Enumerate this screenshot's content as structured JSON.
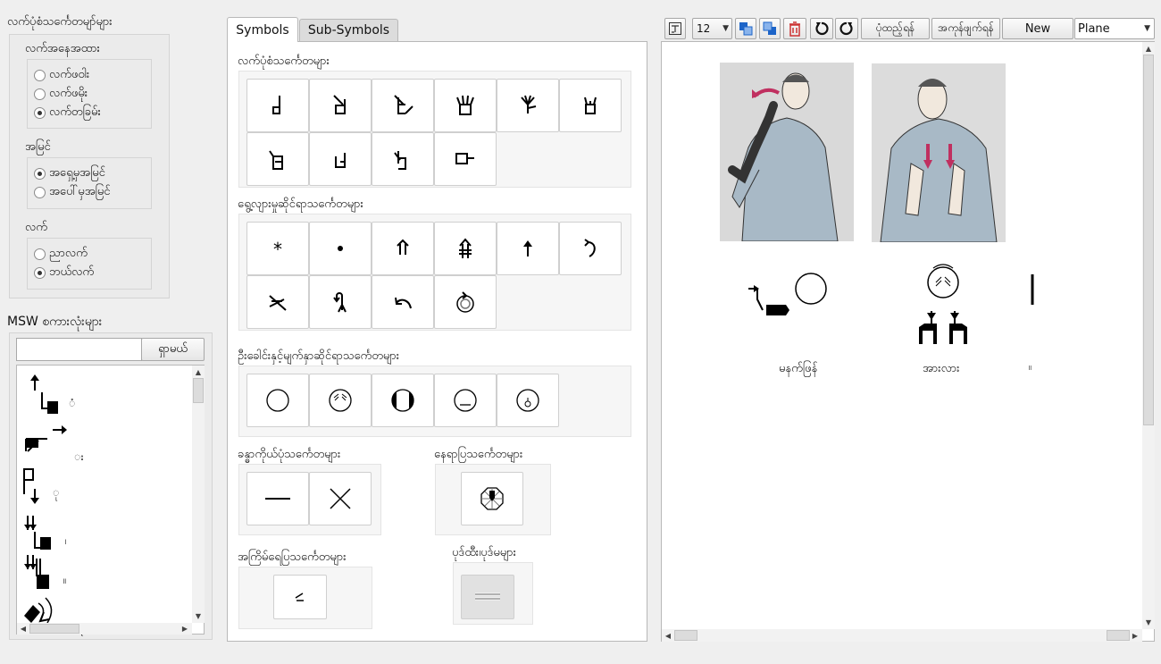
{
  "left": {
    "handshapes_title": "လက်ပုံစံသင်္ကေတမျာ်များ",
    "hand_position_title": "လက်အနေအထား",
    "hand_position_options": [
      "လက်ဖဝါး",
      "လက်ဖမိုး",
      "လက်တခြမ်း"
    ],
    "hand_position_selected": 2,
    "view_title": "အမြင်",
    "view_options": [
      "အရှေ့မှအမြင်",
      "အပေါ်မှအမြင်"
    ],
    "view_selected": 0,
    "hand_title": "လက်",
    "hand_options": [
      "ညာလက်",
      "ဘယ်လက်"
    ],
    "hand_selected": 1,
    "msw_title": "MSW စကားလုံးများ",
    "search_value": "",
    "search_button": "ရှာမယ်",
    "word_marks": [
      "ံ",
      "း",
      "ု",
      "၊",
      "။",
      "("
    ]
  },
  "middle": {
    "tabs": [
      "Symbols",
      "Sub-Symbols"
    ],
    "active_tab": 0,
    "categories": {
      "handshape": "လက်ပုံစံသင်္ကေတများ",
      "movement": "ရွေ့လျားမှုဆိုင်ရာသင်္ကေတများ",
      "head": "ဦးခေါင်းနှင့်မျက်နှာဆိုင်ရာသင်္ကေတများ",
      "body": "ခန္ဓာကိုယ်ပုံသင်္ကေတများ",
      "location": "နေရာပြသင်္ကေတများ",
      "dynamics": "အကြိမ်ရေပြသင်္ကေတများ",
      "punctuation": "ပုဒ်ထီး၊ပုဒ်မများ"
    }
  },
  "right": {
    "font_size": "12",
    "save_label": "ပုံထည့်ရန်",
    "delete_label": "အကုန်ဖျက်ရန်",
    "new_label": "New",
    "mode_value": "Plane",
    "words": [
      "မနက်ဖြန်",
      "အားလား",
      "။"
    ]
  }
}
